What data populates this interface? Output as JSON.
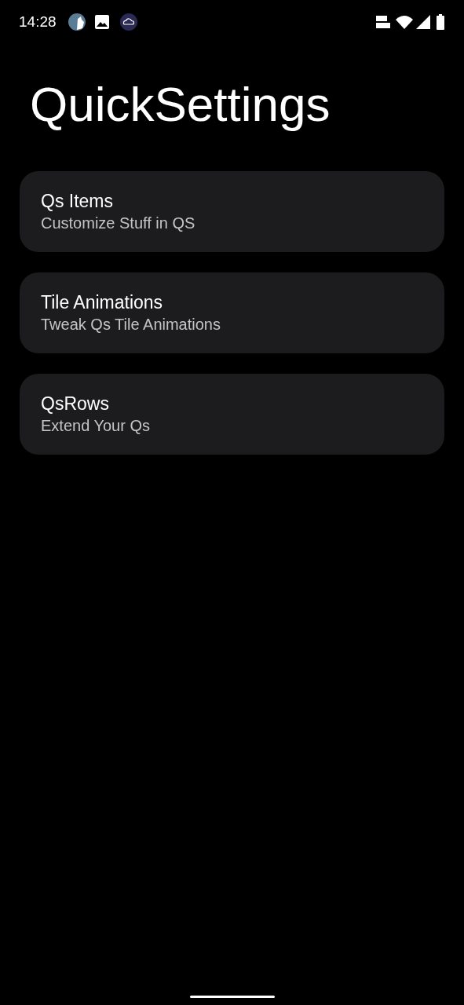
{
  "status_bar": {
    "time": "14:28"
  },
  "title": "QuickSettings",
  "items": [
    {
      "title": "Qs Items",
      "subtitle": "Customize Stuff in QS"
    },
    {
      "title": "Tile Animations",
      "subtitle": "Tweak Qs Tile Animations"
    },
    {
      "title": "QsRows",
      "subtitle": "Extend Your Qs"
    }
  ]
}
